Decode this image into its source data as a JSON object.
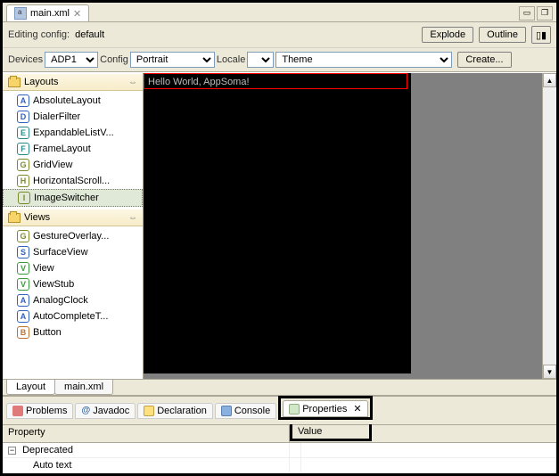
{
  "editor": {
    "filename": "main.xml",
    "config_label": "Editing config:",
    "config_value": "default"
  },
  "topbuttons": {
    "explode": "Explode",
    "outline": "Outline"
  },
  "config": {
    "devices_label": "Devices",
    "devices_value": "ADP1",
    "config_label": "Config",
    "config_value": "Portrait",
    "locale_label": "Locale",
    "locale_value": "",
    "theme_value": "Theme",
    "create_label": "Create..."
  },
  "palette": {
    "layouts_header": "Layouts",
    "views_header": "Views",
    "layouts": [
      {
        "letter": "A",
        "cls": "li-blue",
        "label": "AbsoluteLayout"
      },
      {
        "letter": "D",
        "cls": "li-blue",
        "label": "DialerFilter"
      },
      {
        "letter": "E",
        "cls": "li-teal",
        "label": "ExpandableListV..."
      },
      {
        "letter": "F",
        "cls": "li-teal",
        "label": "FrameLayout"
      },
      {
        "letter": "G",
        "cls": "li-olive",
        "label": "GridView"
      },
      {
        "letter": "H",
        "cls": "li-olive",
        "label": "HorizontalScroll..."
      },
      {
        "letter": "I",
        "cls": "li-olive",
        "label": "ImageSwitcher"
      }
    ],
    "views": [
      {
        "letter": "G",
        "cls": "li-olive",
        "label": "GestureOverlay..."
      },
      {
        "letter": "S",
        "cls": "li-blue",
        "label": "SurfaceView"
      },
      {
        "letter": "V",
        "cls": "li-green",
        "label": "View"
      },
      {
        "letter": "V",
        "cls": "li-green",
        "label": "ViewStub"
      },
      {
        "letter": "A",
        "cls": "li-blue",
        "label": "AnalogClock"
      },
      {
        "letter": "A",
        "cls": "li-blue",
        "label": "AutoCompleteT..."
      },
      {
        "letter": "B",
        "cls": "li-orange",
        "label": "Button"
      }
    ]
  },
  "canvas": {
    "text": "Hello World, AppSoma!"
  },
  "tabs": {
    "layout": "Layout",
    "xml": "main.xml"
  },
  "bottomviews": {
    "problems": "Problems",
    "javadoc": "Javadoc",
    "declaration": "Declaration",
    "console": "Console",
    "properties": "Properties"
  },
  "propgrid": {
    "col0": "Property",
    "col1": "Value",
    "group": "Deprecated",
    "item": "Auto text"
  }
}
